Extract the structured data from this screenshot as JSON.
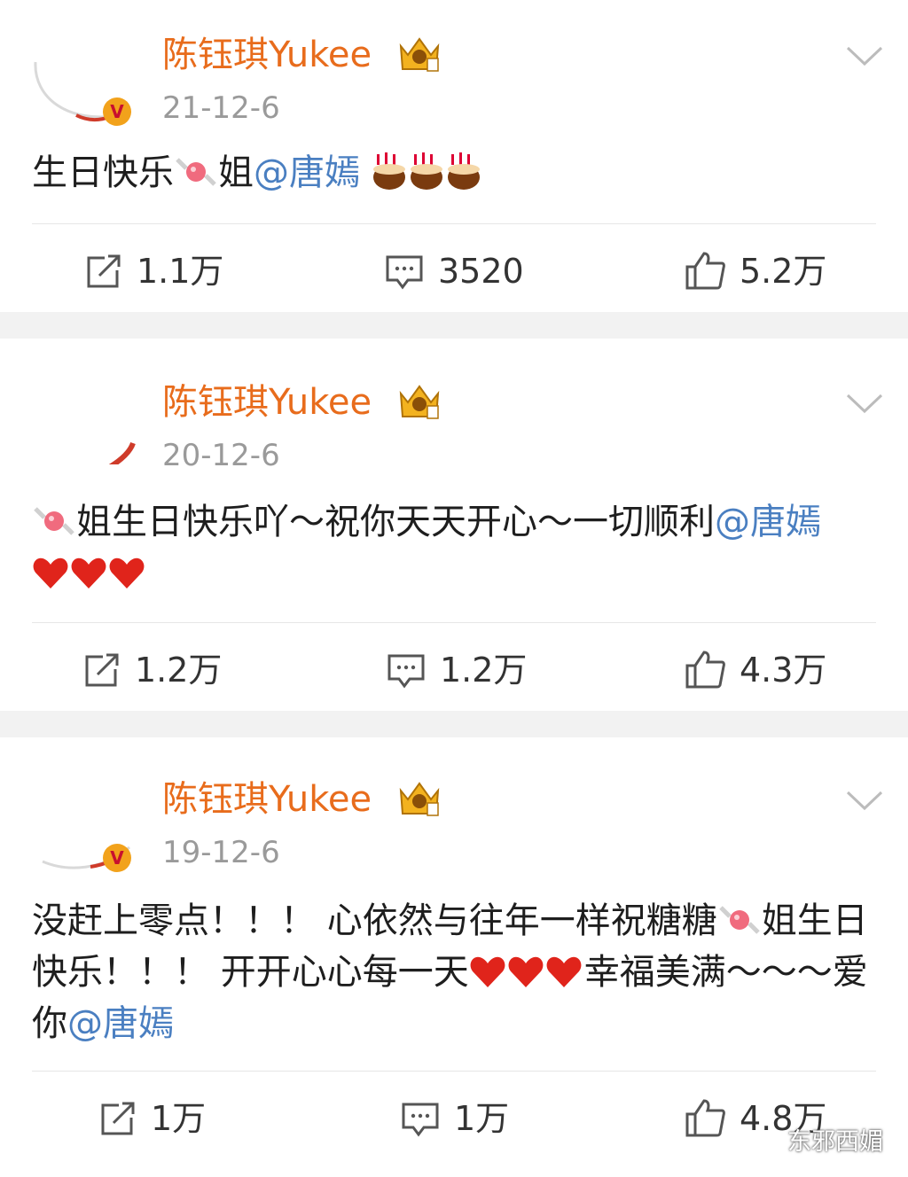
{
  "posts": [
    {
      "username": "陈钰琪Yukee",
      "date": "21-12-6",
      "text": [
        "生日快乐",
        "姐",
        "@唐嫣"
      ],
      "reposts": "1.1万",
      "comments": "3520",
      "likes": "5.2万"
    },
    {
      "username": "陈钰琪Yukee",
      "date": "20-12-6",
      "text": [
        "姐生日快乐吖～祝你天天开心～一切顺利",
        "@唐嫣"
      ],
      "reposts": "1.2万",
      "comments": "1.2万",
      "likes": "4.3万"
    },
    {
      "username": "陈钰琪Yukee",
      "date": "19-12-6",
      "text": [
        "没赶上零点！！！ 心依然与往年一样祝糖糖",
        "姐生日快乐！！！ 开开心心每一天",
        "幸福美满～～～爱你",
        "@唐嫣"
      ],
      "reposts": "1万",
      "comments": "1万",
      "likes": "4.8万"
    }
  ],
  "watermark": "东邪西媚",
  "icons": {
    "repost": "share-box-icon",
    "comment": "comment-bubble-icon",
    "like": "thumbs-up-icon",
    "vip": "crown-badge-icon",
    "menu": "chevron-down-icon"
  },
  "colors": {
    "username": "#e86c1c",
    "mention": "#4a7fc1",
    "date": "#9a9a9a",
    "heart": "#e0241b"
  }
}
